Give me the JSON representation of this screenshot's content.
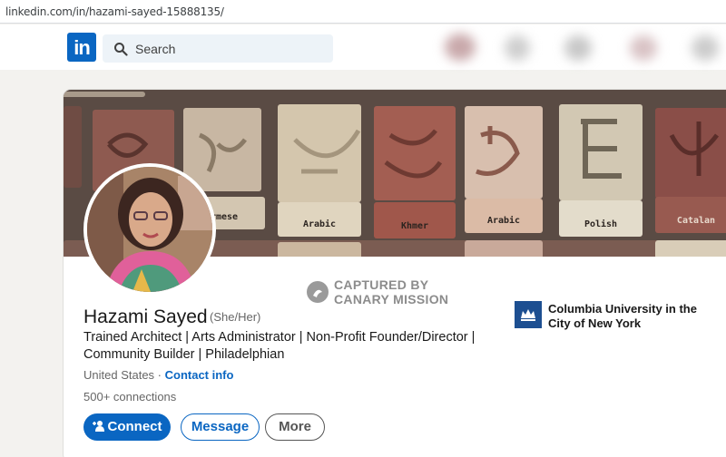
{
  "browser": {
    "url": "linkedin.com/in/hazami-sayed-15888135/"
  },
  "nav": {
    "logo_text": "in",
    "search_placeholder": "Search"
  },
  "banner": {
    "tile_labels": [
      "rmese",
      "Arabic",
      "Khmer",
      "Arabic",
      "Polish",
      "Catalan"
    ]
  },
  "watermark": {
    "line1": "CAPTURED BY",
    "line2": "CANARY MISSION"
  },
  "profile": {
    "name": "Hazami Sayed",
    "pronouns": "(She/Her)",
    "headline": "Trained Architect | Arts Administrator | Non-Profit Founder/Director | Community Builder | Philadelphian",
    "location": "United States",
    "separator": " · ",
    "contact_info": "Contact info",
    "connections": "500+ connections"
  },
  "actions": {
    "connect": "Connect",
    "message": "Message",
    "more": "More"
  },
  "education": {
    "name": "Columbia University in the City of New York"
  },
  "colors": {
    "brand": "#0a66c2",
    "columbia": "#1d4f91"
  }
}
